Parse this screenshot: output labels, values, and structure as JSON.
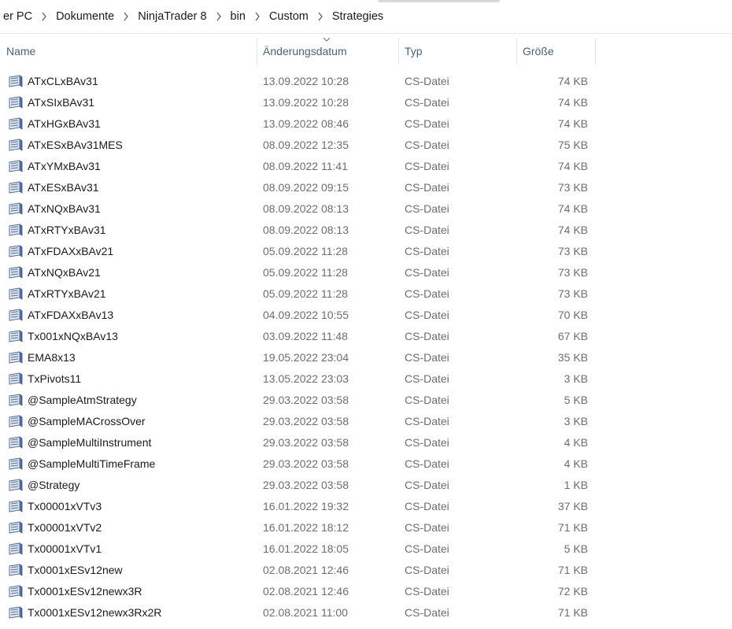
{
  "breadcrumb": [
    "er PC",
    "Dokumente",
    "NinjaTrader 8",
    "bin",
    "Custom",
    "Strategies"
  ],
  "columns": {
    "name": "Name",
    "date": "Änderungsdatum",
    "type": "Typ",
    "size": "Größe"
  },
  "sort": {
    "column": "date",
    "icon": "sort-chevron-icon"
  },
  "file_icon": "cs-file-icon",
  "files": [
    {
      "name": "ATxCLxBAv31",
      "date": "13.09.2022 10:28",
      "type": "CS-Datei",
      "size": "74 KB"
    },
    {
      "name": "ATxSIxBAv31",
      "date": "13.09.2022 10:28",
      "type": "CS-Datei",
      "size": "74 KB"
    },
    {
      "name": "ATxHGxBAv31",
      "date": "13.09.2022 08:46",
      "type": "CS-Datei",
      "size": "74 KB"
    },
    {
      "name": "ATxESxBAv31MES",
      "date": "08.09.2022 12:35",
      "type": "CS-Datei",
      "size": "75 KB"
    },
    {
      "name": "ATxYMxBAv31",
      "date": "08.09.2022 11:41",
      "type": "CS-Datei",
      "size": "74 KB"
    },
    {
      "name": "ATxESxBAv31",
      "date": "08.09.2022 09:15",
      "type": "CS-Datei",
      "size": "73 KB"
    },
    {
      "name": "ATxNQxBAv31",
      "date": "08.09.2022 08:13",
      "type": "CS-Datei",
      "size": "74 KB"
    },
    {
      "name": "ATxRTYxBAv31",
      "date": "08.09.2022 08:13",
      "type": "CS-Datei",
      "size": "74 KB"
    },
    {
      "name": "ATxFDAXxBAv21",
      "date": "05.09.2022 11:28",
      "type": "CS-Datei",
      "size": "73 KB"
    },
    {
      "name": "ATxNQxBAv21",
      "date": "05.09.2022 11:28",
      "type": "CS-Datei",
      "size": "73 KB"
    },
    {
      "name": "ATxRTYxBAv21",
      "date": "05.09.2022 11:28",
      "type": "CS-Datei",
      "size": "73 KB"
    },
    {
      "name": "ATxFDAXxBAv13",
      "date": "04.09.2022 10:55",
      "type": "CS-Datei",
      "size": "70 KB"
    },
    {
      "name": "Tx001xNQxBAv13",
      "date": "03.09.2022 11:48",
      "type": "CS-Datei",
      "size": "67 KB"
    },
    {
      "name": "EMA8x13",
      "date": "19.05.2022 23:04",
      "type": "CS-Datei",
      "size": "35 KB"
    },
    {
      "name": "TxPivots11",
      "date": "13.05.2022 23:03",
      "type": "CS-Datei",
      "size": "3 KB"
    },
    {
      "name": "@SampleAtmStrategy",
      "date": "29.03.2022 03:58",
      "type": "CS-Datei",
      "size": "5 KB"
    },
    {
      "name": "@SampleMACrossOver",
      "date": "29.03.2022 03:58",
      "type": "CS-Datei",
      "size": "3 KB"
    },
    {
      "name": "@SampleMultiInstrument",
      "date": "29.03.2022 03:58",
      "type": "CS-Datei",
      "size": "4 KB"
    },
    {
      "name": "@SampleMultiTimeFrame",
      "date": "29.03.2022 03:58",
      "type": "CS-Datei",
      "size": "4 KB"
    },
    {
      "name": "@Strategy",
      "date": "29.03.2022 03:58",
      "type": "CS-Datei",
      "size": "1 KB"
    },
    {
      "name": "Tx00001xVTv3",
      "date": "16.01.2022 19:32",
      "type": "CS-Datei",
      "size": "37 KB"
    },
    {
      "name": "Tx00001xVTv2",
      "date": "16.01.2022 18:12",
      "type": "CS-Datei",
      "size": "71 KB"
    },
    {
      "name": "Tx00001xVTv1",
      "date": "16.01.2022 18:05",
      "type": "CS-Datei",
      "size": "5 KB"
    },
    {
      "name": "Tx0001xESv12new",
      "date": "02.08.2021 12:46",
      "type": "CS-Datei",
      "size": "71 KB"
    },
    {
      "name": "Tx0001xESv12newx3R",
      "date": "02.08.2021 12:46",
      "type": "CS-Datei",
      "size": "72 KB"
    },
    {
      "name": "Tx0001xESv12newx3Rx2R",
      "date": "02.08.2021 11:00",
      "type": "CS-Datei",
      "size": "71 KB"
    }
  ]
}
